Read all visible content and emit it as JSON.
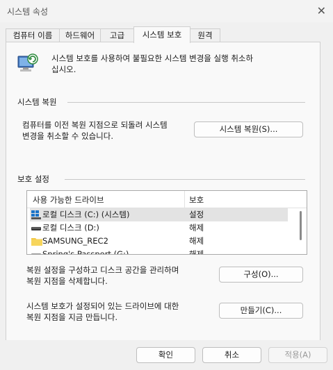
{
  "window": {
    "title": "시스템 속성"
  },
  "tabs": [
    {
      "label": "컴퓨터 이름"
    },
    {
      "label": "하드웨어"
    },
    {
      "label": "고급"
    },
    {
      "label": "시스템 보호"
    },
    {
      "label": "원격"
    }
  ],
  "intro": {
    "text_line1": "시스템 보호를 사용하여 불필요한 시스템 변경을 실행 취소하",
    "text_line2": "십시오."
  },
  "restore": {
    "heading": "시스템 복원",
    "desc_line1": "컴퓨터를 이전 복원 지점으로 되돌려 시스템",
    "desc_line2": "변경을 취소할 수 있습니다.",
    "button": "시스템 복원(S)..."
  },
  "protection": {
    "heading": "보호 설정",
    "columns": {
      "drive": "사용 가능한 드라이브",
      "protection": "보호"
    },
    "drives": [
      {
        "name": "로컬 디스크 (C:) (시스템)",
        "status": "설정",
        "icon": "windows-drive-icon"
      },
      {
        "name": "로컬 디스크 (D:)",
        "status": "해제",
        "icon": "drive-icon"
      },
      {
        "name": "SAMSUNG_REC2",
        "status": "해제",
        "icon": "folder-icon"
      },
      {
        "name": "Spring's Passport (G:)",
        "status": "해제",
        "icon": "drive-icon"
      }
    ],
    "configure_line1": "복원 설정을 구성하고 디스크 공간을 관리하며",
    "configure_line2": "복원 지점을 삭제합니다.",
    "configure_button": "구성(O)...",
    "create_line1": "시스템 보호가 설정되어 있는 드라이브에 대한",
    "create_line2": "복원 지점을 지금 만듭니다.",
    "create_button": "만들기(C)..."
  },
  "footer": {
    "ok": "확인",
    "cancel": "취소",
    "apply": "적용(A)"
  }
}
